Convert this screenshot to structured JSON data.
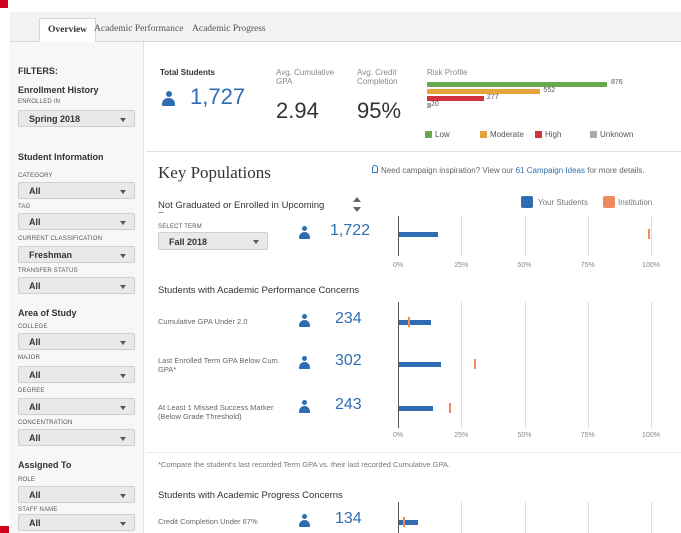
{
  "tabs": [
    {
      "label": "Overview"
    },
    {
      "label": "Academic Performance"
    },
    {
      "label": "Academic Progress"
    }
  ],
  "sidebar": {
    "filters_title": "FILTERS:",
    "enrollment_history": {
      "heading": "Enrollment History",
      "enrolled_in_label": "ENROLLED IN",
      "enrolled_in_value": "Spring 2018"
    },
    "student_information": {
      "heading": "Student Information",
      "category_label": "CATEGORY",
      "category_value": "All",
      "tag_label": "TAG",
      "tag_value": "All",
      "classification_label": "CURRENT CLASSIFICATION",
      "classification_value": "Freshman",
      "transfer_label": "TRANSFER STATUS",
      "transfer_value": "All"
    },
    "area_of_study": {
      "heading": "Area of Study",
      "college_label": "COLLEGE",
      "college_value": "All",
      "major_label": "MAJOR",
      "major_value": "All",
      "degree_label": "DEGREE",
      "degree_value": "All",
      "concentration_label": "CONCENTRATION",
      "concentration_value": "All"
    },
    "assigned_to": {
      "heading": "Assigned To",
      "role_label": "ROLE",
      "role_value": "All",
      "staff_label": "STAFF NAME",
      "staff_value": "All"
    }
  },
  "summary": {
    "total_students_label": "Total Students",
    "total_students_value": "1,727",
    "gpa_label_1": "Avg. Cumulative",
    "gpa_label_2": "GPA",
    "gpa_value": "2.94",
    "credit_label_1": "Avg. Credit",
    "credit_label_2": "Completion",
    "credit_value": "95%",
    "risk_title": "Risk Profile",
    "risk": [
      {
        "name": "Low",
        "value": 876,
        "label": "876",
        "color": "#6aa84f"
      },
      {
        "name": "Moderate",
        "value": 552,
        "label": "552",
        "color": "#e6a23c"
      },
      {
        "name": "High",
        "value": 277,
        "label": "277",
        "color": "#d0343a"
      },
      {
        "name": "Unknown",
        "value": 20,
        "label": "20",
        "color": "#aaaaaa"
      }
    ]
  },
  "key_populations": {
    "title": "Key Populations",
    "campaign_pre": "Need campaign inspiration? View our ",
    "campaign_link": "61 Campaign Ideas",
    "campaign_post": " for more details.",
    "legend_your": "Your Students",
    "legend_institution": "Institution",
    "legend_your_color": "#2f6db3",
    "legend_institution_color": "#f08a5d",
    "not_graduated_label": "Not Graduated or Enrolled in Upcoming Term",
    "select_term_label": "SELECT TERM",
    "select_term_value": "Fall 2018",
    "not_graduated_count": "1,722",
    "ticks": [
      "0%",
      "25%",
      "50%",
      "75%",
      "100%"
    ],
    "academic_performance_title": "Students with Academic Performance Concerns",
    "academic_progress_title": "Students with Academic Progress Concerns",
    "footnote": "*Compare the student's last recorded Term GPA vs. their last recorded Cumulative GPA."
  },
  "chart_data": {
    "type": "bar",
    "series_names": [
      "Your Students",
      "Institution"
    ],
    "rows": [
      {
        "label": "Not Graduated or Enrolled in Upcoming Term",
        "count": "1,722",
        "your_pct": 16,
        "inst_pct": 99
      },
      {
        "label": "Cumulative GPA Under 2.0",
        "count": "234",
        "your_pct": 13,
        "inst_pct": 4
      },
      {
        "label": "Last Enrolled Term GPA Below Cum. GPA*",
        "count": "302",
        "your_pct": 17,
        "inst_pct": 30
      },
      {
        "label": "At Least 1 Missed Success Marker (Below Grade Threshold)",
        "count": "243",
        "your_pct": 14,
        "inst_pct": 20
      },
      {
        "label": "Credit Completion Under 67%",
        "count": "134",
        "your_pct": 8,
        "inst_pct": 2
      }
    ],
    "xlim": [
      0,
      100
    ]
  }
}
